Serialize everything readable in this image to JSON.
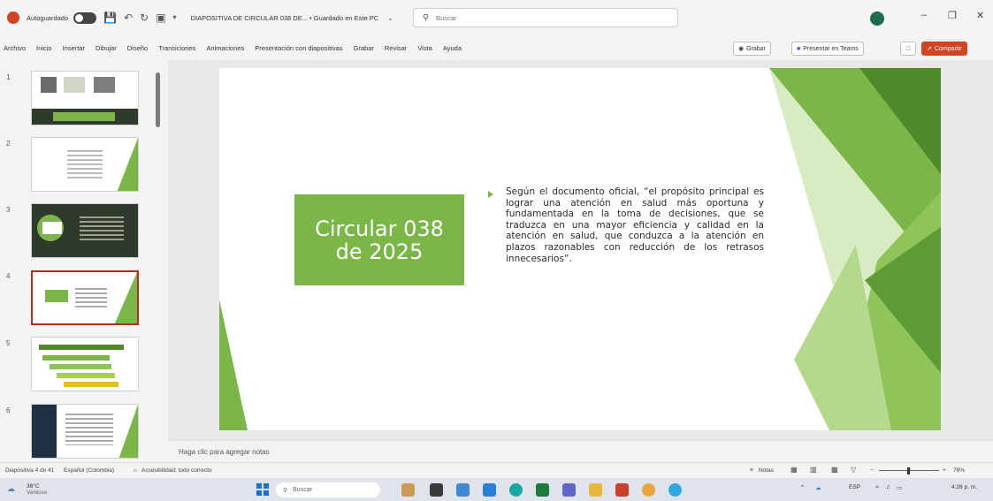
{
  "window": {
    "autosave_label": "Autoguardado",
    "doc_title": "DIAPOSITIVA DE CIRCULAR 038 DE... • Guardado en Este PC",
    "search_placeholder": "Buscar"
  },
  "ribbon": {
    "tabs": [
      "Archivo",
      "Inicio",
      "Insertar",
      "Dibujar",
      "Diseño",
      "Transiciones",
      "Animaciones",
      "Presentación con diapositivas",
      "Grabar",
      "Revisar",
      "Vista",
      "Ayuda"
    ],
    "record_label": "Grabar",
    "teams_label": "Presentar en Teams",
    "share_label": "Compartir"
  },
  "slide_numbers": [
    "1",
    "2",
    "3",
    "4",
    "5",
    "6"
  ],
  "slide": {
    "title": "Circular 038\nde 2025",
    "body": "Según el documento oficial, “el propósito principal es lograr una atención en salud más oportuna y fundamentada en la toma de decisiones, que se traduzca en una mayor eficiencia y calidad en la atención en salud, que conduzca a la atención en plazos razonables con reducción de los retrasos innecesarios”."
  },
  "notes_placeholder": "Haga clic para agregar notas",
  "status": {
    "slide_count": "Diapositiva 4 de 41",
    "language": "Español (Colombia)",
    "accessibility": "Accesibilidad: todo correcto",
    "notes": "Notas",
    "zoom": "78%"
  },
  "taskbar": {
    "temperature": "36°C",
    "weather": "Ventoso",
    "search": "Buscar",
    "lang": "ESP",
    "time": "4:28 p. m."
  },
  "colors": {
    "accent": "#7ab648",
    "accent_dark": "#4e8a2a",
    "office_red": "#d04423"
  }
}
